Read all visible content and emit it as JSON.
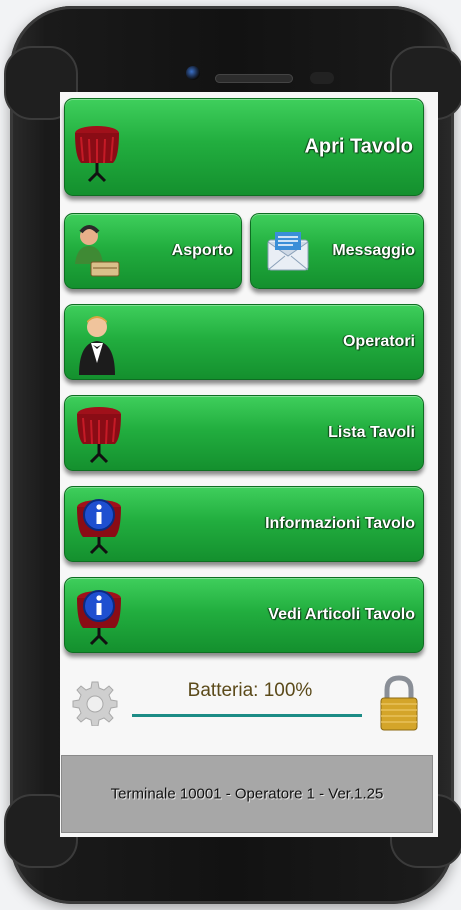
{
  "menu": {
    "apri_tavolo": "Apri Tavolo",
    "asporto": "Asporto",
    "messaggio": "Messaggio",
    "operatori": "Operatori",
    "lista_tavoli": "Lista Tavoli",
    "informazioni_tavolo": "Informazioni Tavolo",
    "vedi_articoli_tavolo": "Vedi Articoli Tavolo"
  },
  "status": {
    "battery_label": "Batteria: 100%",
    "battery_level": 1.0
  },
  "footer": {
    "text": "Terminale 10001 - Operatore 1 - Ver.1.25"
  },
  "colors": {
    "button_green": "#22ae3f",
    "battery_bar": "#1c8c86",
    "footer_bg": "#a7a7a7"
  },
  "icons": [
    "table-icon",
    "delivery-person-icon",
    "envelope-icon",
    "waiter-icon",
    "info-table-icon",
    "gear-icon",
    "padlock-icon"
  ]
}
